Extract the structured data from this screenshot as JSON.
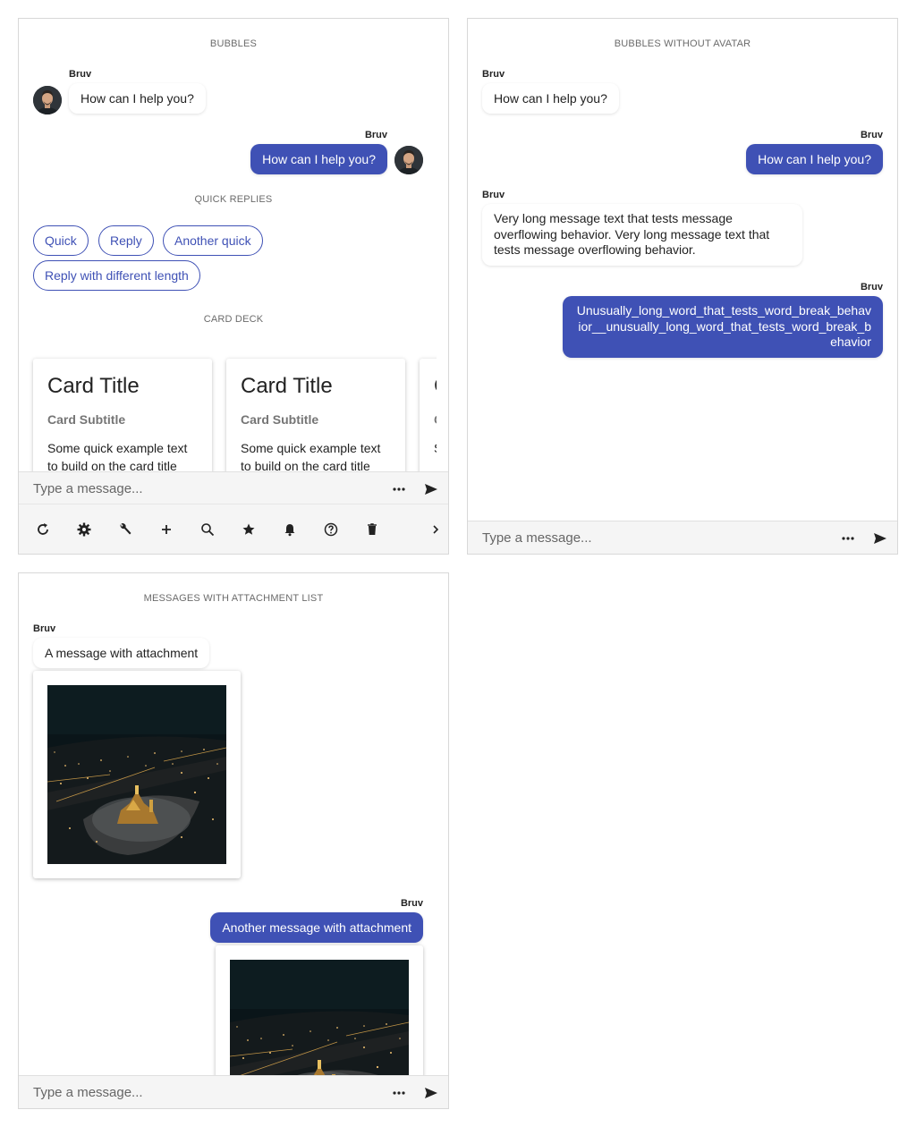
{
  "composer": {
    "placeholder": "Type a message..."
  },
  "panels": {
    "bubbles": {
      "title": "BUBBLES",
      "messages": [
        {
          "sender": "Bruv",
          "text": "How can I help you?"
        },
        {
          "sender": "Bruv",
          "text": "How can I help you?"
        }
      ],
      "quick_replies_title": "QUICK REPLIES",
      "quick_replies": [
        "Quick",
        "Reply",
        "Another quick",
        "Reply with different length"
      ],
      "card_deck_title": "CARD DECK",
      "cards": [
        {
          "title": "Card Title",
          "subtitle": "Card Subtitle",
          "text": "Some quick example text to build on the card title"
        },
        {
          "title": "Card Title",
          "subtitle": "Card Subtitle",
          "text": "Some quick example text to build on the card title"
        },
        {
          "title": "C",
          "subtitle": "C",
          "text": "S t"
        }
      ],
      "toolbar_icons": [
        "refresh-icon",
        "settings-icon",
        "wrench-icon",
        "plus-icon",
        "search-icon",
        "star-icon",
        "bell-icon",
        "help-icon",
        "trash-icon",
        "chevron-right-icon"
      ]
    },
    "no_avatar": {
      "title": "BUBBLES WITHOUT AVATAR",
      "messages": [
        {
          "sender": "Bruv",
          "text": "How can I help you?"
        },
        {
          "sender": "Bruv",
          "text": "How can I help you?"
        },
        {
          "sender": "Bruv",
          "text": "Very long message text that tests message overflowing behavior. Very long message text that tests message overflowing behavior."
        },
        {
          "sender": "Bruv",
          "text": "Unusually_long_word_that_tests_word_break_behavior__unusually_long_word_that_tests_word_break_behavior"
        }
      ]
    },
    "attachments": {
      "title": "MESSAGES WITH ATTACHMENT LIST",
      "messages": [
        {
          "sender": "Bruv",
          "text": "A message with attachment"
        },
        {
          "sender": "Bruv",
          "text": "Another message with attachment"
        }
      ]
    }
  },
  "colors": {
    "accent": "#3f51b5",
    "incoming_bubble": "#ffffff",
    "composer_bg": "#f5f5f5"
  }
}
